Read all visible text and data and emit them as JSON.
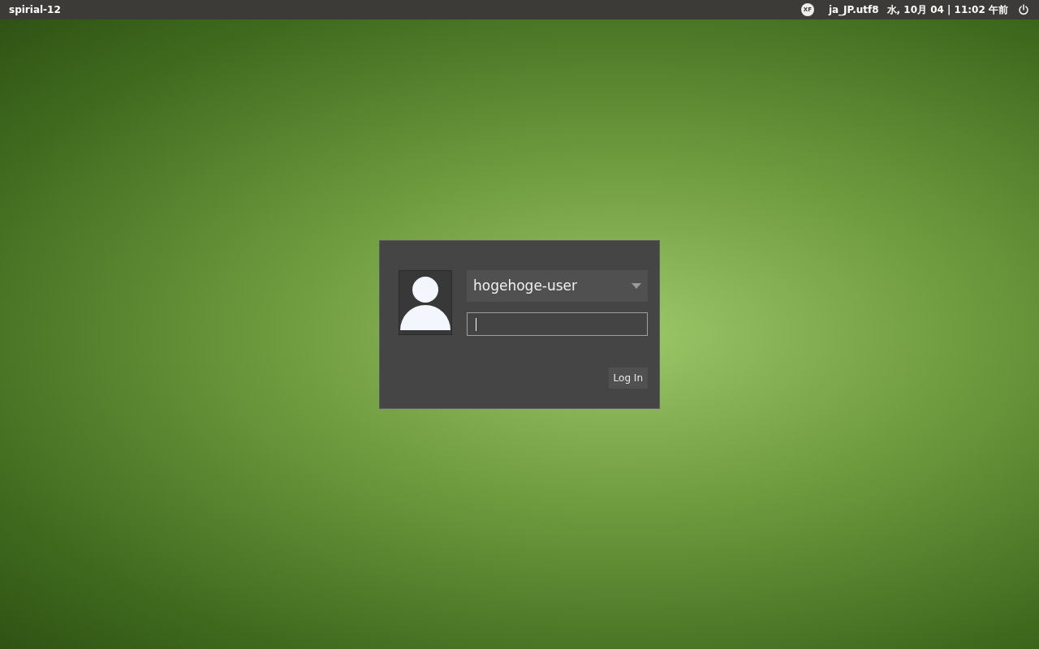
{
  "top_bar": {
    "hostname": "spirial-12",
    "keyboard_indicator": "XF",
    "locale": "ja_JP.utf8",
    "datetime": "水, 10月 04 | 11:02 午前"
  },
  "login": {
    "user": "hogehoge-user",
    "password": {
      "focused": true
    },
    "button": "Log In"
  }
}
